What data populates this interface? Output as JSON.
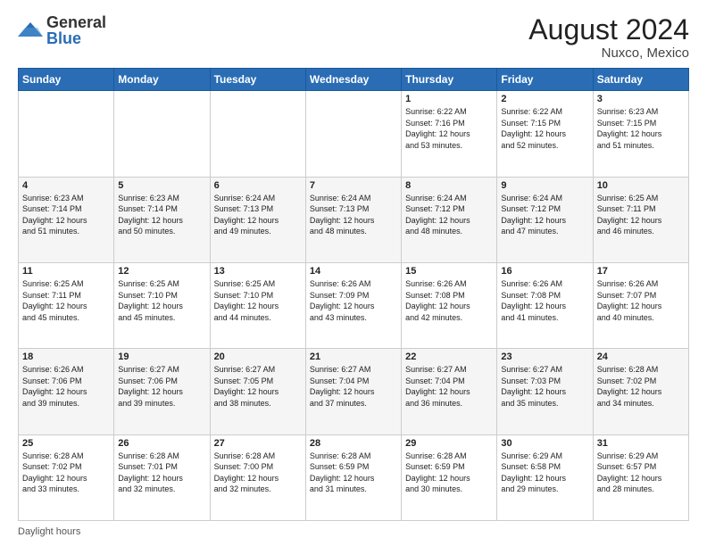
{
  "header": {
    "logo_general": "General",
    "logo_blue": "Blue",
    "title": "August 2024",
    "location": "Nuxco, Mexico"
  },
  "days_of_week": [
    "Sunday",
    "Monday",
    "Tuesday",
    "Wednesday",
    "Thursday",
    "Friday",
    "Saturday"
  ],
  "weeks": [
    [
      {
        "day": "",
        "info": ""
      },
      {
        "day": "",
        "info": ""
      },
      {
        "day": "",
        "info": ""
      },
      {
        "day": "",
        "info": ""
      },
      {
        "day": "1",
        "info": "Sunrise: 6:22 AM\nSunset: 7:16 PM\nDaylight: 12 hours\nand 53 minutes."
      },
      {
        "day": "2",
        "info": "Sunrise: 6:22 AM\nSunset: 7:15 PM\nDaylight: 12 hours\nand 52 minutes."
      },
      {
        "day": "3",
        "info": "Sunrise: 6:23 AM\nSunset: 7:15 PM\nDaylight: 12 hours\nand 51 minutes."
      }
    ],
    [
      {
        "day": "4",
        "info": "Sunrise: 6:23 AM\nSunset: 7:14 PM\nDaylight: 12 hours\nand 51 minutes."
      },
      {
        "day": "5",
        "info": "Sunrise: 6:23 AM\nSunset: 7:14 PM\nDaylight: 12 hours\nand 50 minutes."
      },
      {
        "day": "6",
        "info": "Sunrise: 6:24 AM\nSunset: 7:13 PM\nDaylight: 12 hours\nand 49 minutes."
      },
      {
        "day": "7",
        "info": "Sunrise: 6:24 AM\nSunset: 7:13 PM\nDaylight: 12 hours\nand 48 minutes."
      },
      {
        "day": "8",
        "info": "Sunrise: 6:24 AM\nSunset: 7:12 PM\nDaylight: 12 hours\nand 48 minutes."
      },
      {
        "day": "9",
        "info": "Sunrise: 6:24 AM\nSunset: 7:12 PM\nDaylight: 12 hours\nand 47 minutes."
      },
      {
        "day": "10",
        "info": "Sunrise: 6:25 AM\nSunset: 7:11 PM\nDaylight: 12 hours\nand 46 minutes."
      }
    ],
    [
      {
        "day": "11",
        "info": "Sunrise: 6:25 AM\nSunset: 7:11 PM\nDaylight: 12 hours\nand 45 minutes."
      },
      {
        "day": "12",
        "info": "Sunrise: 6:25 AM\nSunset: 7:10 PM\nDaylight: 12 hours\nand 45 minutes."
      },
      {
        "day": "13",
        "info": "Sunrise: 6:25 AM\nSunset: 7:10 PM\nDaylight: 12 hours\nand 44 minutes."
      },
      {
        "day": "14",
        "info": "Sunrise: 6:26 AM\nSunset: 7:09 PM\nDaylight: 12 hours\nand 43 minutes."
      },
      {
        "day": "15",
        "info": "Sunrise: 6:26 AM\nSunset: 7:08 PM\nDaylight: 12 hours\nand 42 minutes."
      },
      {
        "day": "16",
        "info": "Sunrise: 6:26 AM\nSunset: 7:08 PM\nDaylight: 12 hours\nand 41 minutes."
      },
      {
        "day": "17",
        "info": "Sunrise: 6:26 AM\nSunset: 7:07 PM\nDaylight: 12 hours\nand 40 minutes."
      }
    ],
    [
      {
        "day": "18",
        "info": "Sunrise: 6:26 AM\nSunset: 7:06 PM\nDaylight: 12 hours\nand 39 minutes."
      },
      {
        "day": "19",
        "info": "Sunrise: 6:27 AM\nSunset: 7:06 PM\nDaylight: 12 hours\nand 39 minutes."
      },
      {
        "day": "20",
        "info": "Sunrise: 6:27 AM\nSunset: 7:05 PM\nDaylight: 12 hours\nand 38 minutes."
      },
      {
        "day": "21",
        "info": "Sunrise: 6:27 AM\nSunset: 7:04 PM\nDaylight: 12 hours\nand 37 minutes."
      },
      {
        "day": "22",
        "info": "Sunrise: 6:27 AM\nSunset: 7:04 PM\nDaylight: 12 hours\nand 36 minutes."
      },
      {
        "day": "23",
        "info": "Sunrise: 6:27 AM\nSunset: 7:03 PM\nDaylight: 12 hours\nand 35 minutes."
      },
      {
        "day": "24",
        "info": "Sunrise: 6:28 AM\nSunset: 7:02 PM\nDaylight: 12 hours\nand 34 minutes."
      }
    ],
    [
      {
        "day": "25",
        "info": "Sunrise: 6:28 AM\nSunset: 7:02 PM\nDaylight: 12 hours\nand 33 minutes."
      },
      {
        "day": "26",
        "info": "Sunrise: 6:28 AM\nSunset: 7:01 PM\nDaylight: 12 hours\nand 32 minutes."
      },
      {
        "day": "27",
        "info": "Sunrise: 6:28 AM\nSunset: 7:00 PM\nDaylight: 12 hours\nand 32 minutes."
      },
      {
        "day": "28",
        "info": "Sunrise: 6:28 AM\nSunset: 6:59 PM\nDaylight: 12 hours\nand 31 minutes."
      },
      {
        "day": "29",
        "info": "Sunrise: 6:28 AM\nSunset: 6:59 PM\nDaylight: 12 hours\nand 30 minutes."
      },
      {
        "day": "30",
        "info": "Sunrise: 6:29 AM\nSunset: 6:58 PM\nDaylight: 12 hours\nand 29 minutes."
      },
      {
        "day": "31",
        "info": "Sunrise: 6:29 AM\nSunset: 6:57 PM\nDaylight: 12 hours\nand 28 minutes."
      }
    ]
  ],
  "footer": {
    "daylight_label": "Daylight hours"
  }
}
